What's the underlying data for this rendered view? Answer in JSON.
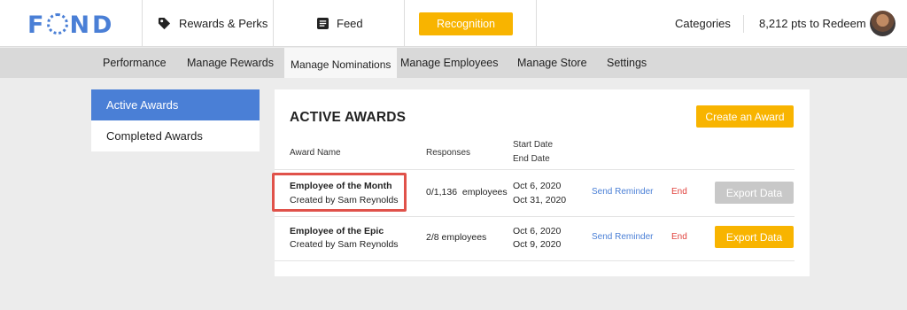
{
  "logo": {
    "text_before": "F",
    "text_after": "ND"
  },
  "topnav": {
    "rewards_label": "Rewards & Perks",
    "feed_label": "Feed",
    "recognition_label": "Recognition",
    "categories_label": "Categories",
    "points_label": "8,212 pts to Redeem"
  },
  "subnav": {
    "items": [
      "Performance",
      "Manage Rewards",
      "Manage Nominations",
      "Manage Employees",
      "Manage Store",
      "Settings"
    ],
    "active": "Manage Nominations"
  },
  "sidebar": {
    "items": [
      {
        "label": "Active Awards",
        "active": true
      },
      {
        "label": "Completed Awards",
        "active": false
      }
    ]
  },
  "awards": {
    "title": "ACTIVE AWARDS",
    "create_label": "Create an Award",
    "headers": {
      "name": "Award Name",
      "responses": "Responses",
      "start": "Start Date",
      "end": "End Date"
    },
    "rows": [
      {
        "name": "Employee of the Month",
        "creator": "Created by Sam Reynolds",
        "responses": "0/1,136  employees",
        "start": "Oct 6, 2020",
        "end": "Oct 31, 2020",
        "reminder": "Send Reminder",
        "end_action": "End",
        "export": "Export Data",
        "export_enabled": false
      },
      {
        "name": "Employee of the Epic",
        "creator": "Created by Sam Reynolds",
        "responses": "2/8 employees",
        "start": "Oct 6, 2020",
        "end": "Oct 9, 2020",
        "reminder": "Send Reminder",
        "end_action": "End",
        "export": "Export Data",
        "export_enabled": true
      }
    ]
  },
  "colors": {
    "accent": "#f8b400",
    "brand_blue": "#4a7fd6",
    "danger": "#e0413c",
    "highlight": "#e0524a"
  }
}
